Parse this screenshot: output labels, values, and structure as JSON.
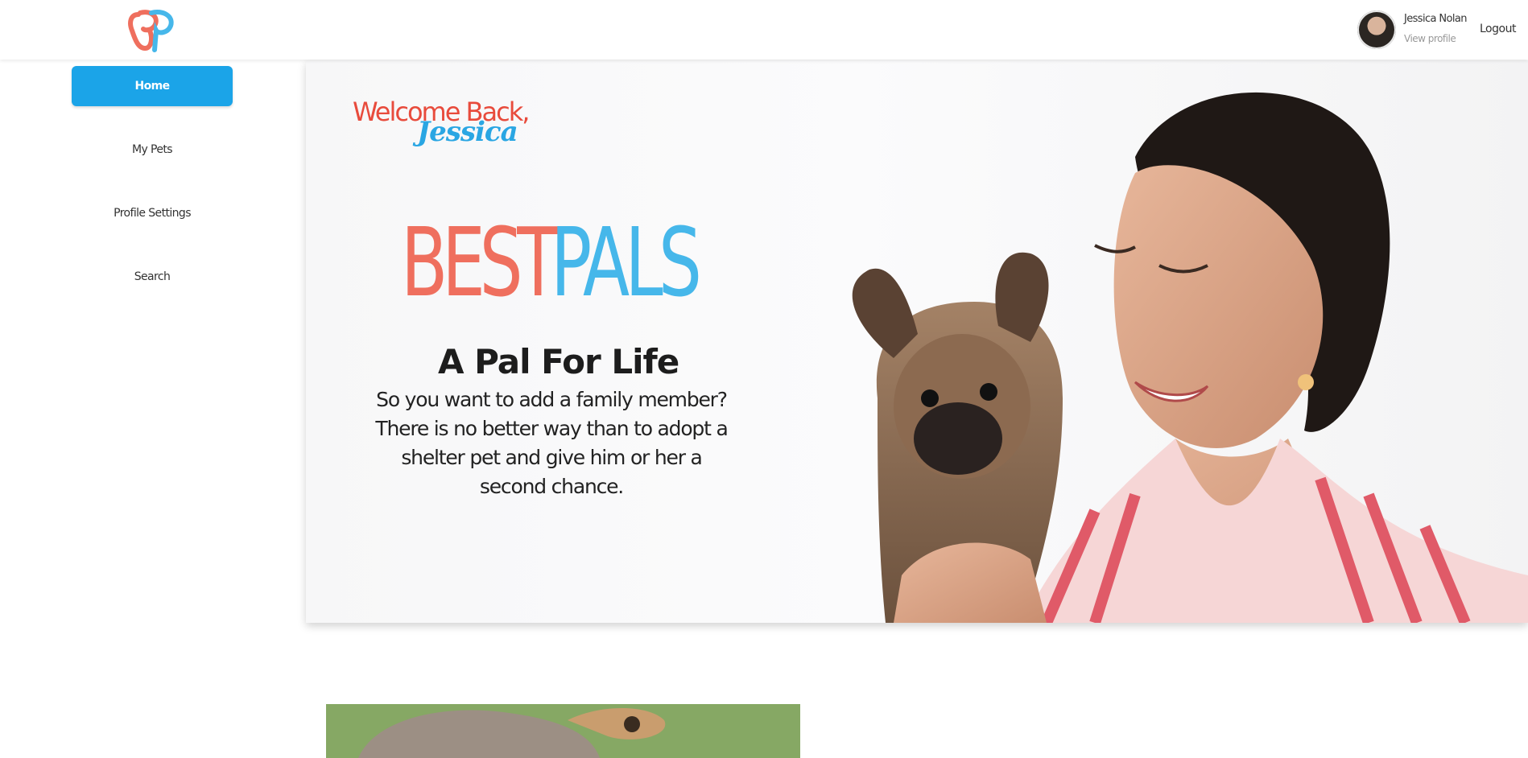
{
  "header": {
    "logo_icon": "bestpals-logo-icon",
    "user": {
      "name": "Jessica Nolan",
      "view_profile": "View profile",
      "avatar_icon": "user-avatar"
    },
    "logout_label": "Logout"
  },
  "sidebar": {
    "items": [
      {
        "label": "Home",
        "active": true
      },
      {
        "label": "My Pets",
        "active": false
      },
      {
        "label": "Profile Settings",
        "active": false
      },
      {
        "label": "Search",
        "active": false
      }
    ]
  },
  "hero": {
    "welcome": "Welcome Back,",
    "welcome_name": "Jessica",
    "brand_first": "BEST",
    "brand_second": "PALS",
    "tagline": "A Pal For Life",
    "blurb": "So you want to add a family member? There is no better way than to adopt a shelter pet and give him or her a second chance.",
    "photo_icon": "woman-with-puppy-photo"
  },
  "colors": {
    "accent_blue": "#1ba4e8",
    "brand_red": "#ef6f5e",
    "brand_blue": "#46b7ea",
    "welcome_red": "#e84b3c"
  }
}
